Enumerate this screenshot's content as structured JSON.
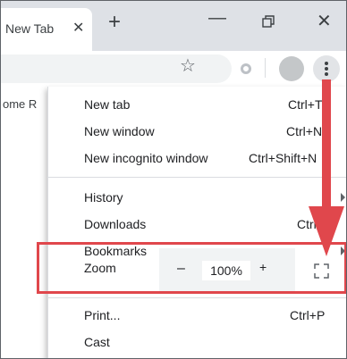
{
  "tab": {
    "title": "New Tab"
  },
  "bookmarks": {
    "partial_text": "ome R"
  },
  "menu": {
    "items": [
      {
        "label": "New tab",
        "shortcut": "Ctrl+T"
      },
      {
        "label": "New window",
        "shortcut": "Ctrl+N"
      },
      {
        "label": "New incognito window",
        "shortcut": "Ctrl+Shift+N"
      },
      {
        "label": "History",
        "submenu": true
      },
      {
        "label": "Downloads",
        "shortcut": "Ctrl+J"
      },
      {
        "label": "Bookmarks",
        "submenu": true
      },
      {
        "label": "Print...",
        "shortcut": "Ctrl+P"
      },
      {
        "label": "Cast"
      }
    ],
    "zoom": {
      "label": "Zoom",
      "minus": "–",
      "value": "100%",
      "plus": "+"
    }
  },
  "colors": {
    "annotation": "#e0474c",
    "tabstrip": "#dee1e6",
    "zoom_control": "#f1f3f4"
  },
  "icons": [
    "close-icon",
    "plus-icon",
    "minimize-icon",
    "restore-icon",
    "star-icon",
    "extension-icon",
    "profile-icon",
    "more-vert-icon",
    "chevron-right-icon",
    "fullscreen-icon"
  ]
}
